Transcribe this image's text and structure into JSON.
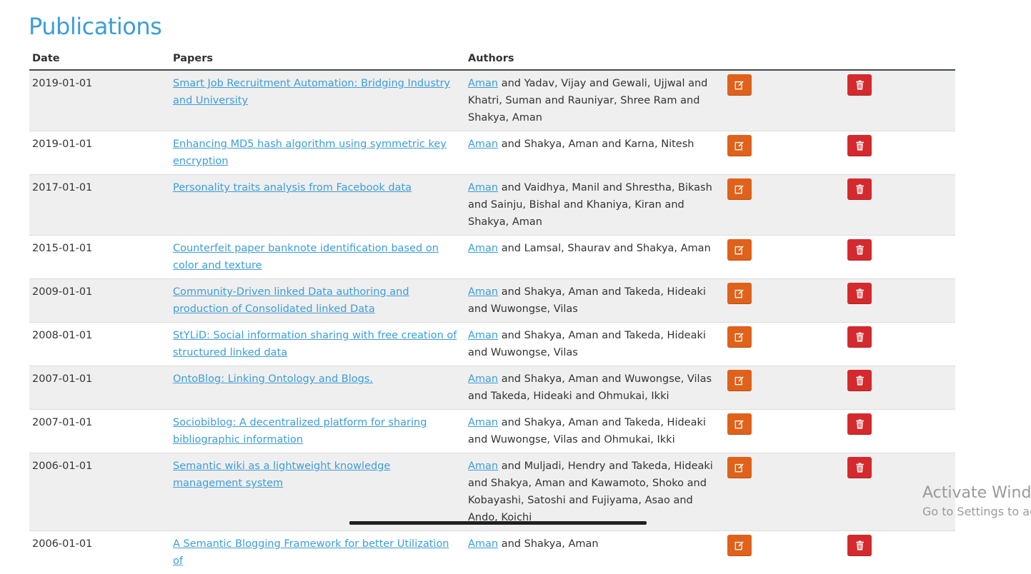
{
  "page": {
    "title": "Publications"
  },
  "table": {
    "headers": {
      "date": "Date",
      "papers": "Papers",
      "authors": "Authors"
    },
    "rows": [
      {
        "date": "2019-01-01",
        "paper": "Smart Job Recruitment Automation: Bridging Industry and University",
        "author_link": "Aman",
        "authors_rest": " and Yadav, Vijay and Gewali, Ujjwal and Khatri, Suman and Rauniyar, Shree Ram and Shakya, Aman"
      },
      {
        "date": "2019-01-01",
        "paper": "Enhancing MD5 hash algorithm using symmetric key encryption",
        "author_link": "Aman",
        "authors_rest": " and Shakya, Aman and Karna, Nitesh"
      },
      {
        "date": "2017-01-01",
        "paper": "Personality traits analysis from Facebook data",
        "author_link": "Aman",
        "authors_rest": " and Vaidhya, Manil and Shrestha, Bikash and Sainju, Bishal and Khaniya, Kiran and Shakya, Aman"
      },
      {
        "date": "2015-01-01",
        "paper": "Counterfeit paper banknote identification based on color and texture",
        "author_link": "Aman",
        "authors_rest": " and Lamsal, Shaurav and Shakya, Aman"
      },
      {
        "date": "2009-01-01",
        "paper": "Community-Driven linked Data authoring and production of Consolidated linked Data",
        "author_link": "Aman",
        "authors_rest": " and Shakya, Aman and Takeda, Hideaki and Wuwongse, Vilas"
      },
      {
        "date": "2008-01-01",
        "paper": "StYLiD: Social information sharing with free creation of structured linked data",
        "author_link": "Aman",
        "authors_rest": " and Shakya, Aman and Takeda, Hideaki and Wuwongse, Vilas"
      },
      {
        "date": "2007-01-01",
        "paper": "OntoBlog: Linking Ontology and Blogs.",
        "author_link": "Aman",
        "authors_rest": " and Shakya, Aman and Wuwongse, Vilas and Takeda, Hideaki and Ohmukai, Ikki"
      },
      {
        "date": "2007-01-01",
        "paper": "Sociobiblog: A decentralized platform for sharing bibliographic information",
        "author_link": "Aman",
        "authors_rest": " and Shakya, Aman and Takeda, Hideaki and Wuwongse, Vilas and Ohmukai, Ikki"
      },
      {
        "date": "2006-01-01",
        "paper": "Semantic wiki as a lightweight knowledge management system",
        "author_link": "Aman",
        "authors_rest": " and Muljadi, Hendry and Takeda, Hideaki and Shakya, Aman and Kawamoto, Shoko and Kobayashi, Satoshi and Fujiyama, Asao and Ando, Koichi"
      },
      {
        "date": "2006-01-01",
        "paper": "A Semantic Blogging Framework for better Utilization of",
        "author_link": "Aman",
        "authors_rest": " and Shakya, Aman"
      }
    ],
    "icons": {
      "edit": "edit-icon",
      "delete": "trash-icon"
    }
  },
  "watermark": {
    "line1": "Activate Wind",
    "line2": "Go to Settings to ac"
  },
  "colors": {
    "title": "#3c9dd8",
    "link": "#3c9dd8",
    "edit_button": "#e0611a",
    "delete_button": "#d42a2e",
    "row_stripe": "#efefef"
  }
}
